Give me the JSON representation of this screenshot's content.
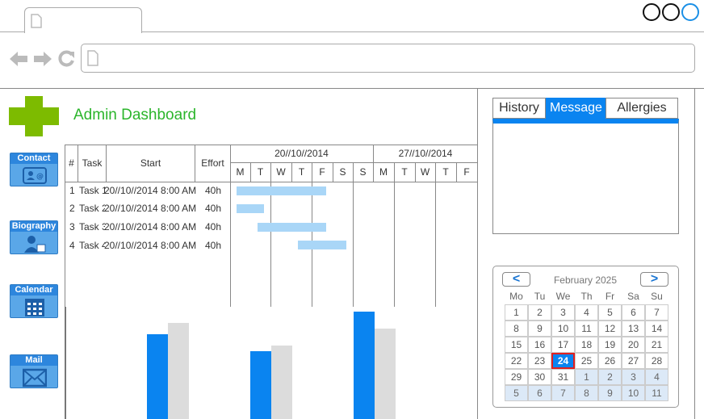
{
  "app": {
    "title": "Admin Dashboard",
    "accent_color": "#0a84f0",
    "brand_color": "#7dbb00"
  },
  "nav": [
    {
      "label": "Contact",
      "icon": "contact-card-icon"
    },
    {
      "label": "Biography",
      "icon": "person-icon"
    },
    {
      "label": "Calendar",
      "icon": "calendar-icon"
    },
    {
      "label": "Mail",
      "icon": "mail-icon"
    }
  ],
  "gantt": {
    "headers": {
      "num": "#",
      "task": "Task",
      "start": "Start",
      "effort": "Effort"
    },
    "weeks": [
      "20//10//2014",
      "27//10//2014"
    ],
    "days": [
      "M",
      "T",
      "W",
      "T",
      "F",
      "S",
      "S",
      "M",
      "T",
      "W",
      "T",
      "F"
    ],
    "rows": [
      {
        "num": "1",
        "task": "Task 1",
        "start": "20//10//2014 8:00 AM",
        "effort": "40h"
      },
      {
        "num": "2",
        "task": "Task 2",
        "start": "20//10//2014 8:00 AM",
        "effort": "40h"
      },
      {
        "num": "3",
        "task": "Task 3",
        "start": "20//10//2014 8:00 AM",
        "effort": "40h"
      },
      {
        "num": "4",
        "task": "Task 4",
        "start": "20//10//2014 8:00 AM",
        "effort": "40h"
      }
    ]
  },
  "right_tabs": {
    "items": [
      "History",
      "Message",
      "Allergies"
    ],
    "active": "Message"
  },
  "calendar": {
    "month_label": "February 2025",
    "prev": "<",
    "next": ">",
    "weekdays": [
      "Mo",
      "Tu",
      "We",
      "Th",
      "Fr",
      "Sa",
      "Su"
    ],
    "weeks": [
      [
        "1",
        "2",
        "3",
        "4",
        "5",
        "6",
        "7"
      ],
      [
        "8",
        "9",
        "10",
        "11",
        "12",
        "13",
        "14"
      ],
      [
        "15",
        "16",
        "17",
        "18",
        "19",
        "20",
        "21"
      ],
      [
        "22",
        "23",
        "24",
        "25",
        "26",
        "27",
        "28"
      ],
      [
        "29",
        "30",
        "31",
        "1",
        "2",
        "3",
        "4"
      ],
      [
        "5",
        "6",
        "7",
        "8",
        "9",
        "10",
        "11"
      ]
    ],
    "today": "24"
  }
}
